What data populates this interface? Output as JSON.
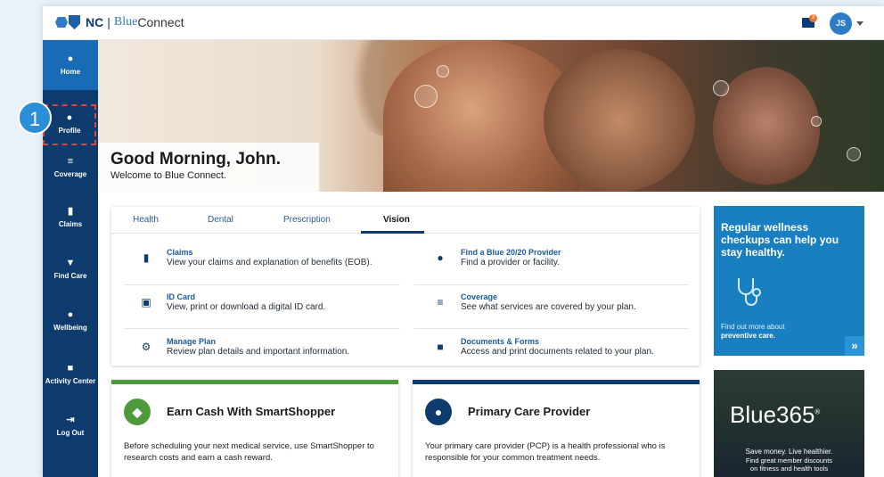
{
  "header": {
    "logo_nc": "NC",
    "logo_sep": "|",
    "logo_blue": "Blue",
    "logo_connect": "Connect",
    "mail_badge": "3",
    "avatar_initials": "JS"
  },
  "step_marker": "1",
  "sidebar": {
    "items": [
      {
        "label": "Home",
        "icon": "home-icon"
      },
      {
        "label": "Profile",
        "icon": "person-icon"
      },
      {
        "label": "Coverage",
        "icon": "list-icon"
      },
      {
        "label": "Claims",
        "icon": "documents-icon"
      },
      {
        "label": "Find Care",
        "icon": "map-pin-icon"
      },
      {
        "label": "Wellbeing",
        "icon": "apple-icon"
      },
      {
        "label": "Activity Center",
        "icon": "inbox-icon"
      },
      {
        "label": "Log Out",
        "icon": "logout-icon"
      }
    ]
  },
  "hero": {
    "title": "Good Morning, John.",
    "subtitle": "Welcome to Blue Connect."
  },
  "benefits": {
    "tabs": [
      "Health",
      "Dental",
      "Prescription",
      "Vision"
    ],
    "active_tab": "Vision",
    "items": [
      {
        "title": "Claims",
        "desc": "View your claims and explanation of benefits (EOB).",
        "icon": "claims-icon"
      },
      {
        "title": "Find a Blue 20/20 Provider",
        "desc": "Find a provider or facility.",
        "icon": "provider-icon"
      },
      {
        "title": "ID Card",
        "desc": "View, print or download a digital ID card.",
        "icon": "id-card-icon"
      },
      {
        "title": "Coverage",
        "desc": "See what services are covered by your plan.",
        "icon": "coverage-list-icon"
      },
      {
        "title": "Manage Plan",
        "desc": "Review plan details and important information.",
        "icon": "gear-icon"
      },
      {
        "title": "Documents & Forms",
        "desc": "Access and print documents related to your plan.",
        "icon": "folder-icon"
      }
    ]
  },
  "cards": {
    "smartshopper": {
      "title": "Earn Cash With SmartShopper",
      "body": "Before scheduling your next medical service, use SmartShopper to research costs and earn a cash reward."
    },
    "pcp": {
      "title": "Primary Care Provider",
      "body": "Your primary care provider (PCP) is a health professional who is responsible for your common treatment needs."
    }
  },
  "promos": {
    "wellness": {
      "title": "Regular wellness checkups can help you stay healthy.",
      "line1": "Find out more about",
      "line2": "preventive care."
    },
    "blue365": {
      "brand": "Blue365",
      "brand_mark": "®",
      "line1": "Save money. Live healthier.",
      "line2": "Find great member discounts",
      "line3": "on fitness and health tools"
    }
  },
  "colors": {
    "sidebar": "#0e3b6d",
    "sidebar_active": "#1a6bb6",
    "link": "#1a5ba0",
    "smartshopper_green": "#4d9a3c",
    "promo_blue": "#1a7fc1",
    "highlight_red": "#e2453a"
  }
}
